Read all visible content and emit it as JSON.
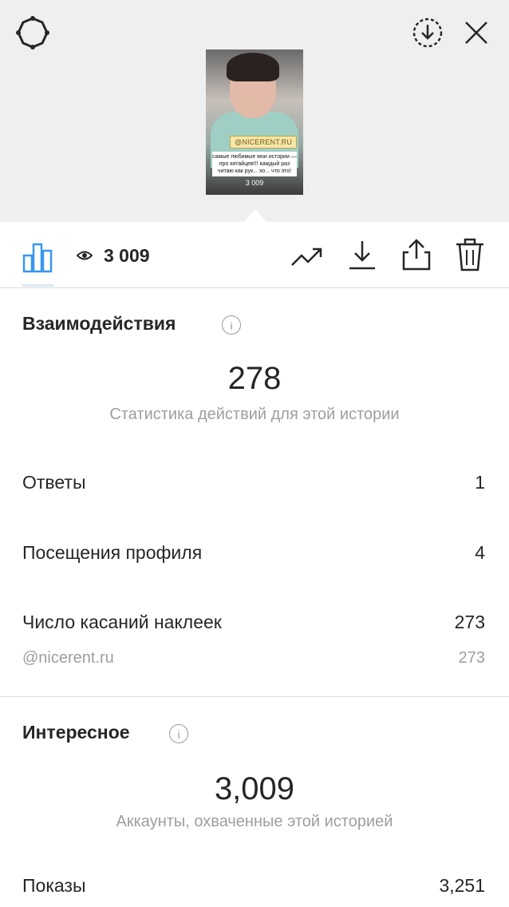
{
  "colors": {
    "accent": "#3897f0",
    "text": "#262626",
    "muted": "#9e9e9e",
    "top_bg": "#efefef"
  },
  "header": {
    "icons": [
      "settings-gear-icon",
      "download-circle-icon",
      "close-icon"
    ]
  },
  "story_thumbnail": {
    "brand_tag": "@NICERENT.RU",
    "caption": "самые любимые мои истории — про китайцев!!! каждый раз читаю как рук... хо... что это!",
    "view_count": "3 009"
  },
  "toolbar": {
    "views": "3 009",
    "icons": [
      "insights-bar-chart-icon",
      "eye-icon",
      "trending-up-icon",
      "download-icon",
      "share-icon",
      "trash-icon"
    ]
  },
  "interactions": {
    "title": "Взаимодействия",
    "total": "278",
    "caption": "Статистика действий для этой истории",
    "rows": [
      {
        "label": "Ответы",
        "value": "1"
      },
      {
        "label": "Посещения профиля",
        "value": "4"
      },
      {
        "label": "Число касаний наклеек",
        "value": "273"
      }
    ],
    "sticker": {
      "label": "@nicerent.ru",
      "value": "273"
    }
  },
  "discovery": {
    "title": "Интересное",
    "total": "3,009",
    "caption": "Аккаунты, охваченные этой историей",
    "rows": [
      {
        "label": "Показы",
        "value": "3,251"
      }
    ]
  }
}
